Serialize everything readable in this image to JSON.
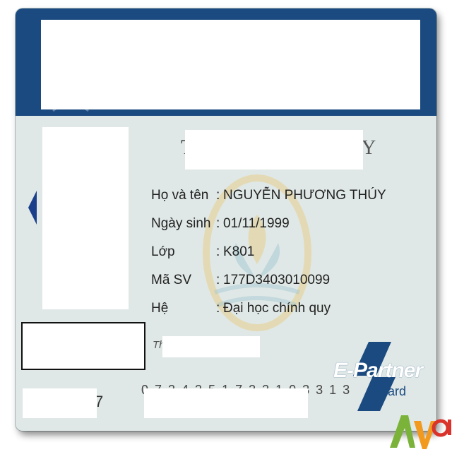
{
  "card": {
    "fields": [
      {
        "label": "Họ và tên",
        "value": "NGUYỄN PHƯƠNG THÚY"
      },
      {
        "label": "Ngày sinh",
        "value": "01/11/1999"
      },
      {
        "label": "Lớp",
        "value": "K801"
      },
      {
        "label": "Mã SV",
        "value": "177D3403010099"
      },
      {
        "label": "Hệ",
        "value": "Đại học chính quy"
      }
    ],
    "separator": ":",
    "title_peek_left": "T",
    "title_peek_right": "Y",
    "sign_prefix": "Th",
    "number_peek": "7",
    "number_peek_right": "0 7 3 4  3 5 1 7  3 3 1 0  3 3 1 3",
    "partner_logo": {
      "main": "E-Partner",
      "sub": "card"
    },
    "corner_logo": {
      "text": "ADviệt"
    }
  },
  "colors": {
    "card_bg": "#dfe8e6",
    "header_band": "#1b4a80",
    "accent_blue": "#1b3f8a",
    "watermark": "#e9c97a"
  }
}
